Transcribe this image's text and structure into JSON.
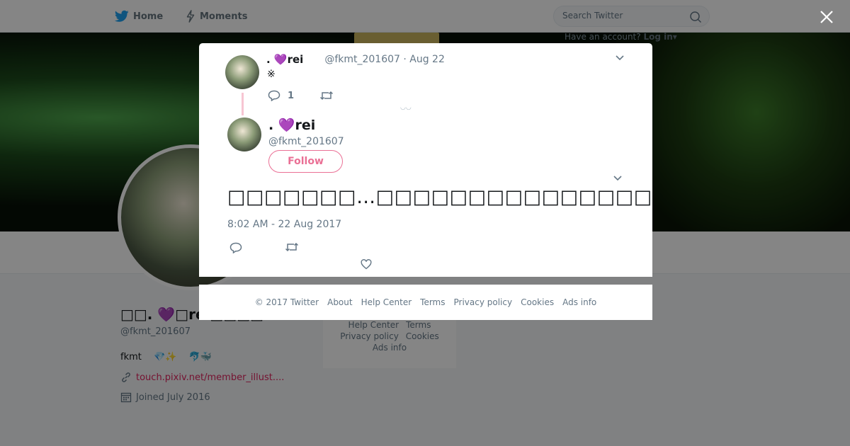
{
  "nav": {
    "home_label": "Home",
    "moments_label": "Moments",
    "search_placeholder": "Search Twitter",
    "account_prompt": "Have an account?",
    "login_label": "Log in"
  },
  "profile": {
    "name": "□□. 💜□rei□□□□",
    "handle": "@fkmt_201607",
    "bio": "fkmt 　💎✨ 　🐬🐳",
    "link": "touch.pixiv.net/member_illust....",
    "joined": "Joined July 2016"
  },
  "background_footer": {
    "row1": [
      "Help Center",
      "Terms"
    ],
    "row2": [
      "Privacy policy",
      "Cookies"
    ],
    "row3": [
      "Ads info"
    ]
  },
  "tweet_parent": {
    "name": ". 💜rei",
    "meta": "@fkmt_201607 · Aug 22",
    "text": "※",
    "reply_count": "1"
  },
  "tweet_main": {
    "name": ". 💜rei",
    "handle": "@fkmt_201607",
    "follow_label": "Follow",
    "text": "□□□□□□□…□□□□□□□□□□□□□□□□□□□□□□□□□□□□□□□□□□□□…",
    "timestamp": "8:02 AM - 22 Aug 2017",
    "extra_mark": "◡◡"
  },
  "modal_footer": {
    "links": [
      "© 2017 Twitter",
      "About",
      "Help Center",
      "Terms",
      "Privacy policy",
      "Cookies",
      "Ads info"
    ]
  },
  "colors": {
    "brand_blue": "#1da1f2",
    "accent_pink": "#e0245e"
  },
  "icons": [
    "twitter-bird-icon",
    "lightning-icon",
    "search-icon",
    "close-icon",
    "chevron-down-icon",
    "reply-icon",
    "retweet-icon",
    "heart-icon",
    "link-icon",
    "calendar-icon"
  ]
}
